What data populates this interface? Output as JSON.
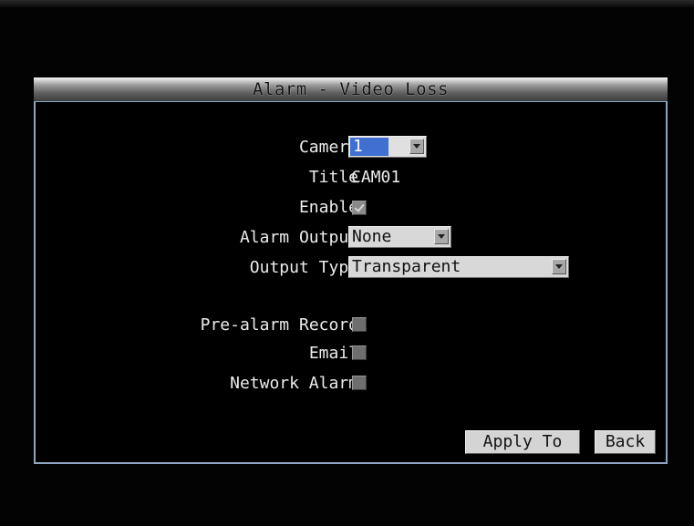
{
  "window": {
    "title": "Alarm - Video Loss"
  },
  "form": {
    "camera": {
      "label": "Camera",
      "value": "1"
    },
    "title": {
      "label": "Title",
      "value": "CAM01"
    },
    "enable": {
      "label": "Enable",
      "checked": true
    },
    "alarm_output": {
      "label": "Alarm Output",
      "value": "None"
    },
    "output_type": {
      "label": "Output Type",
      "value": "Transparent"
    },
    "pre_alarm_record": {
      "label": "Pre-alarm Record",
      "checked": false
    },
    "email": {
      "label": "Email",
      "checked": false
    },
    "network_alarm": {
      "label": "Network Alarm",
      "checked": false
    }
  },
  "buttons": {
    "apply_to": "Apply To",
    "back": "Back"
  },
  "colors": {
    "dialog_border": "#8ea6bf",
    "selection_highlight": "#3f6fd0",
    "control_face": "#d4d4d4"
  }
}
